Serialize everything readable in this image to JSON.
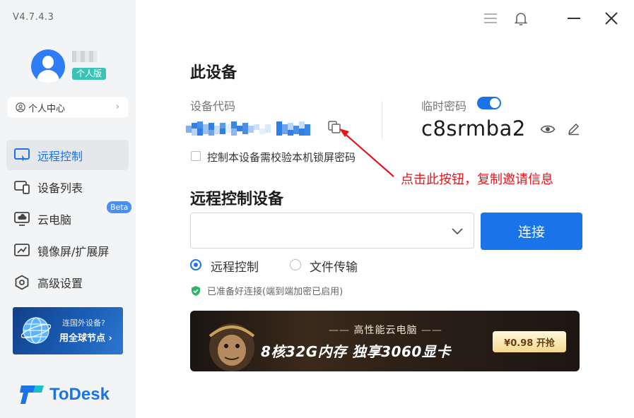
{
  "app": {
    "version": "V4.7.4.3",
    "edition": "个人版",
    "brand": "ToDesk",
    "accent_color": "#1a73e8"
  },
  "sidebar": {
    "personal_center": "个人中心",
    "items": [
      {
        "label": "远程控制",
        "icon": "remote-control-icon",
        "active": true
      },
      {
        "label": "设备列表",
        "icon": "device-list-icon"
      },
      {
        "label": "云电脑",
        "icon": "cloud-pc-icon",
        "badge": "Beta"
      },
      {
        "label": "镜像屏/扩展屏",
        "icon": "mirror-screen-icon"
      },
      {
        "label": "高级设置",
        "icon": "settings-icon"
      }
    ],
    "promo": {
      "line1": "连国外设备?",
      "line2": "用全球节点 ›"
    }
  },
  "this_device": {
    "title": "此设备",
    "code_label": "设备代码",
    "temp_password_label": "临时密码",
    "temp_password": "c8srmba2",
    "temp_password_enabled": true,
    "lock_checkbox_label": "控制本设备需校验本机锁屏密码",
    "lock_checkbox_checked": false
  },
  "annotation": {
    "text": "点击此按钮，复制邀请信息",
    "color": "#e3161b"
  },
  "remote": {
    "title": "远程控制设备",
    "input_value": "",
    "connect_label": "连接",
    "modes": [
      {
        "label": "远程控制",
        "selected": true
      },
      {
        "label": "文件传输",
        "selected": false
      }
    ],
    "status": "已准备好连接(端到端加密已启用)"
  },
  "banner": {
    "subtitle": "高性能云电脑",
    "headline": "8核32G内存  独享3060显卡",
    "price": "¥0.98 开抢"
  }
}
